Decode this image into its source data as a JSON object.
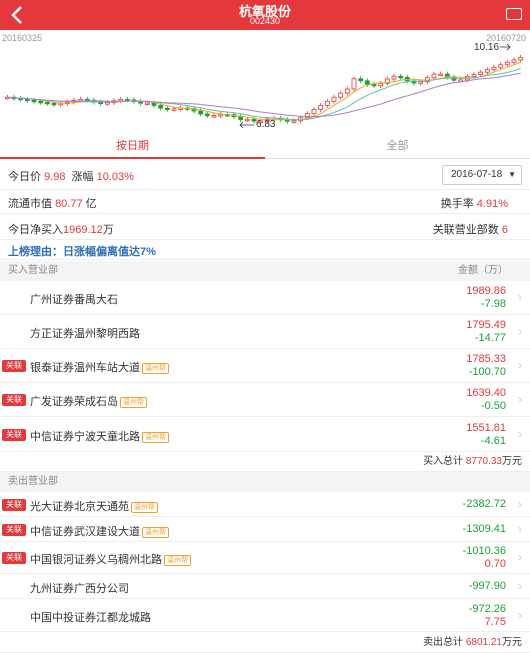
{
  "header": {
    "title": "杭氧股份",
    "code": "002430"
  },
  "chart": {
    "start_date": "20160325",
    "end_date": "20160720",
    "high_label": "10.16",
    "low_label": "6.83",
    "colors": {
      "up": "#e4393c",
      "down": "#1aa337",
      "ma1": "#f5a623",
      "ma2": "#5bc5a6",
      "ma3": "#b07ad6"
    }
  },
  "tabs": [
    {
      "label": "按日期"
    },
    {
      "label": "全部"
    }
  ],
  "summary": {
    "price_label": "今日价",
    "price": "9.98",
    "change_label": "涨幅",
    "change": "10.03%",
    "date": "2016-07-18",
    "market_cap_label": "流通市值",
    "market_cap": "80.77",
    "market_cap_unit": "亿",
    "turnover_label": "换手率",
    "turnover": "4.91%",
    "net_buy_label": "今日净买入",
    "net_buy": "1969.12",
    "net_buy_unit": "万",
    "brokers_label": "关联营业部数",
    "brokers_count": "6"
  },
  "reason": "上榜理由：日涨幅偏离值达7%",
  "buy": {
    "title": "买入营业部",
    "amount_header": "金额（万）",
    "items": [
      {
        "name": "广州证券番禺大石",
        "v1": "1989.86",
        "v2": "-7.98",
        "tag": "",
        "region": ""
      },
      {
        "name": "方正证券温州黎明西路",
        "v1": "1795.49",
        "v2": "-14.77",
        "tag": "",
        "region": ""
      },
      {
        "name": "银泰证券温州车站大道",
        "v1": "1785.33",
        "v2": "-100.70",
        "tag": "关联",
        "region": "温州帮"
      },
      {
        "name": "广发证券荣成石岛",
        "v1": "1639.40",
        "v2": "-0.50",
        "tag": "关联",
        "region": "温州帮"
      },
      {
        "name": "中信证券宁波天童北路",
        "v1": "1551.81",
        "v2": "-4.61",
        "tag": "关联",
        "region": "温州帮"
      }
    ],
    "total_label": "买入总计",
    "total": "8770.33",
    "total_unit": "万元"
  },
  "sell": {
    "title": "卖出营业部",
    "items": [
      {
        "name": "光大证券北京天通苑",
        "v1": "-2382.72",
        "v2": "",
        "tag": "关联",
        "region": "温州帮"
      },
      {
        "name": "中信证券武汉建设大道",
        "v1": "-1309.41",
        "v2": "",
        "tag": "关联",
        "region": "温州帮"
      },
      {
        "name": "中国银河证券义乌稠州北路",
        "v1": "-1010.36",
        "v2": "0.70",
        "tag": "关联",
        "region": "温州帮"
      },
      {
        "name": "九州证券广西分公司",
        "v1": "-997.90",
        "v2": "",
        "tag": "",
        "region": ""
      },
      {
        "name": "中国中投证券江都龙城路",
        "v1": "-972.26",
        "v2": "7.75",
        "tag": "",
        "region": ""
      }
    ],
    "total_label": "卖出总计",
    "total": "6801.21",
    "total_unit": "万元"
  }
}
